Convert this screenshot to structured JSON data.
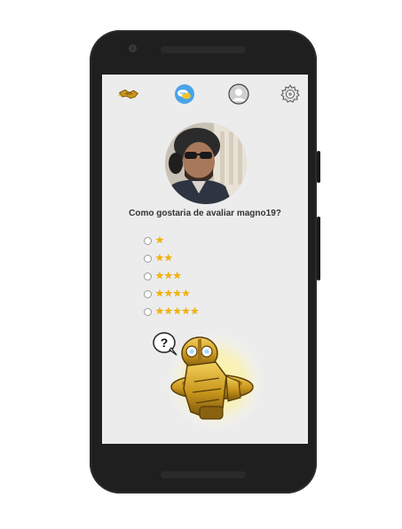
{
  "nav": {
    "items": [
      {
        "icon": "handshake-icon"
      },
      {
        "icon": "chat-icon"
      },
      {
        "icon": "profile-icon"
      },
      {
        "icon": "gear-icon"
      }
    ]
  },
  "profile": {
    "photo": "user-avatar"
  },
  "rating": {
    "question": "Como gostaria de avaliar magno19?",
    "options": [
      {
        "stars": "★",
        "value": 1
      },
      {
        "stars": "★★",
        "value": 2
      },
      {
        "stars": "★★★",
        "value": 3
      },
      {
        "stars": "★★★★",
        "value": 4
      },
      {
        "stars": "★★★★★",
        "value": 5
      }
    ]
  },
  "mascot": {
    "bubble_text": "?"
  },
  "colors": {
    "screen_bg": "#ececec",
    "star": "#f5b400",
    "chat_accent": "#4aa3e8",
    "phone_body": "#1f1f1f"
  }
}
